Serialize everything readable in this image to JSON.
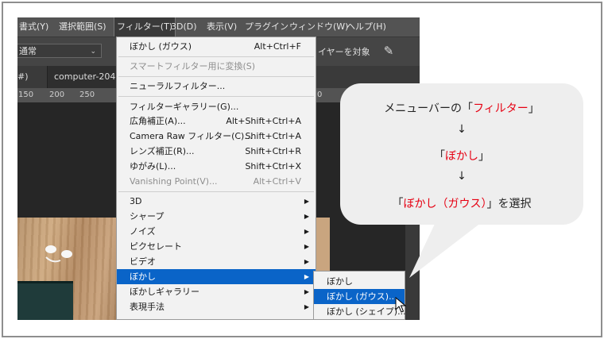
{
  "menubar": {
    "items": [
      "書式(Y)",
      "選択範囲(S)",
      "フィルター(T)",
      "3D(D)",
      "表示(V)",
      "プラグイン",
      "ウィンドウ(W)",
      "ヘルプ(H)"
    ]
  },
  "options_bar": {
    "blend_mode": "通常",
    "layer_target_text": "イヤーを対象"
  },
  "tabs": {
    "tab1": "#)",
    "tab2": "computer-204"
  },
  "ruler": {
    "ticks": [
      "150",
      "200",
      "250",
      "0"
    ]
  },
  "filter_menu": {
    "items": [
      {
        "label": "ぼかし (ガウス)",
        "shortcut": "Alt+Ctrl+F"
      },
      {
        "label": "スマートフィルター用に変換(S)"
      },
      {
        "label": "ニューラルフィルター..."
      },
      {
        "label": "フィルターギャラリー(G)..."
      },
      {
        "label": "広角補正(A)...",
        "shortcut": "Alt+Shift+Ctrl+A"
      },
      {
        "label": "Camera Raw フィルター(C)...",
        "shortcut": "Shift+Ctrl+A"
      },
      {
        "label": "レンズ補正(R)...",
        "shortcut": "Shift+Ctrl+R"
      },
      {
        "label": "ゆがみ(L)...",
        "shortcut": "Shift+Ctrl+X"
      },
      {
        "label": "Vanishing Point(V)...",
        "shortcut": "Alt+Ctrl+V"
      },
      {
        "label": "3D"
      },
      {
        "label": "シャープ"
      },
      {
        "label": "ノイズ"
      },
      {
        "label": "ピクセレート"
      },
      {
        "label": "ビデオ"
      },
      {
        "label": "ぼかし"
      },
      {
        "label": "ぼかしギャラリー"
      },
      {
        "label": "表現手法"
      }
    ]
  },
  "blur_submenu": {
    "items": [
      "ぼかし",
      "ぼかし (ガウス)...",
      "ぼかし (シェイプ)..."
    ]
  },
  "callout": {
    "line1_prefix": "メニューバーの「",
    "line1_red": "フィルター",
    "line1_suffix": "」",
    "arrow1": "↓",
    "line2_prefix": "「",
    "line2_red": "ぼかし",
    "line2_suffix": "」",
    "arrow2": "↓",
    "line3_prefix": "「",
    "line3_red": "ぼかし（ガウス）",
    "line3_suffix": "」を選択"
  },
  "colors": {
    "highlight": "#0a64c8",
    "callout_red": "#e60012"
  }
}
